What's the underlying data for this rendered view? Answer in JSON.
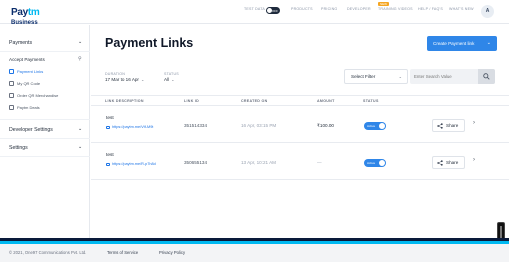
{
  "brand": {
    "logo_main": "Pay",
    "logo_accent": "tm",
    "logo_sub": "Business"
  },
  "topnav": {
    "items": [
      "TEST DATA",
      "PRODUCTS",
      "PRICING",
      "DEVELOPER",
      "TRAINING VIDEOS",
      "HELP / FAQ'S",
      "WHAT'S NEW"
    ],
    "toggle_label": "OFF",
    "new_badge": "NEW",
    "avatar": "A"
  },
  "sidebar": {
    "sections": [
      {
        "label": "Payments",
        "chevron": "⌄"
      },
      {
        "label": "Developer Settings",
        "chevron": "⌄"
      },
      {
        "label": "Settings",
        "chevron": "⌄"
      }
    ],
    "subheading": "Accept Payments",
    "items": [
      {
        "label": "Payment Links",
        "active": true
      },
      {
        "label": "My QR Code",
        "active": false
      },
      {
        "label": "Order QR Merchandise",
        "active": false
      },
      {
        "label": "Paytm Deals",
        "active": false
      }
    ]
  },
  "main": {
    "title": "Payment Links",
    "create_button": "Create Payment link",
    "filters": {
      "duration_label": "DURATION",
      "duration_value": "17 Mar to 16 Apr",
      "status_label": "STATUS",
      "status_value": "All",
      "select_filter": "Select Filter",
      "search_placeholder": "Enter Search Value"
    },
    "table": {
      "headers": [
        "LINK DESCRIPTION",
        "LINK ID",
        "CREATED ON",
        "AMOUNT",
        "STATUS"
      ],
      "rows": [
        {
          "title": "test",
          "link": "https://paytm.me/Vtf-M9t",
          "link_id": "351514334",
          "created": "16 Apr, 03:15 PM",
          "amount": "₹100.00",
          "status": "Active",
          "share": "Share"
        },
        {
          "title": "test",
          "link": "https://paytm.me/R-p7h8d",
          "link_id": "350655134",
          "created": "13 Apr, 10:21 AM",
          "amount": "—",
          "status": "Active",
          "share": "Share"
        }
      ]
    }
  },
  "footer": {
    "copyright": "© 2021, One97 Communications Pvt. Ltd.",
    "terms": "Terms of Service",
    "privacy": "Privacy Policy"
  },
  "colors": {
    "accent": "#2f86e8",
    "brand_navy": "#0b2d6b",
    "brand_sky": "#00b9f1"
  }
}
